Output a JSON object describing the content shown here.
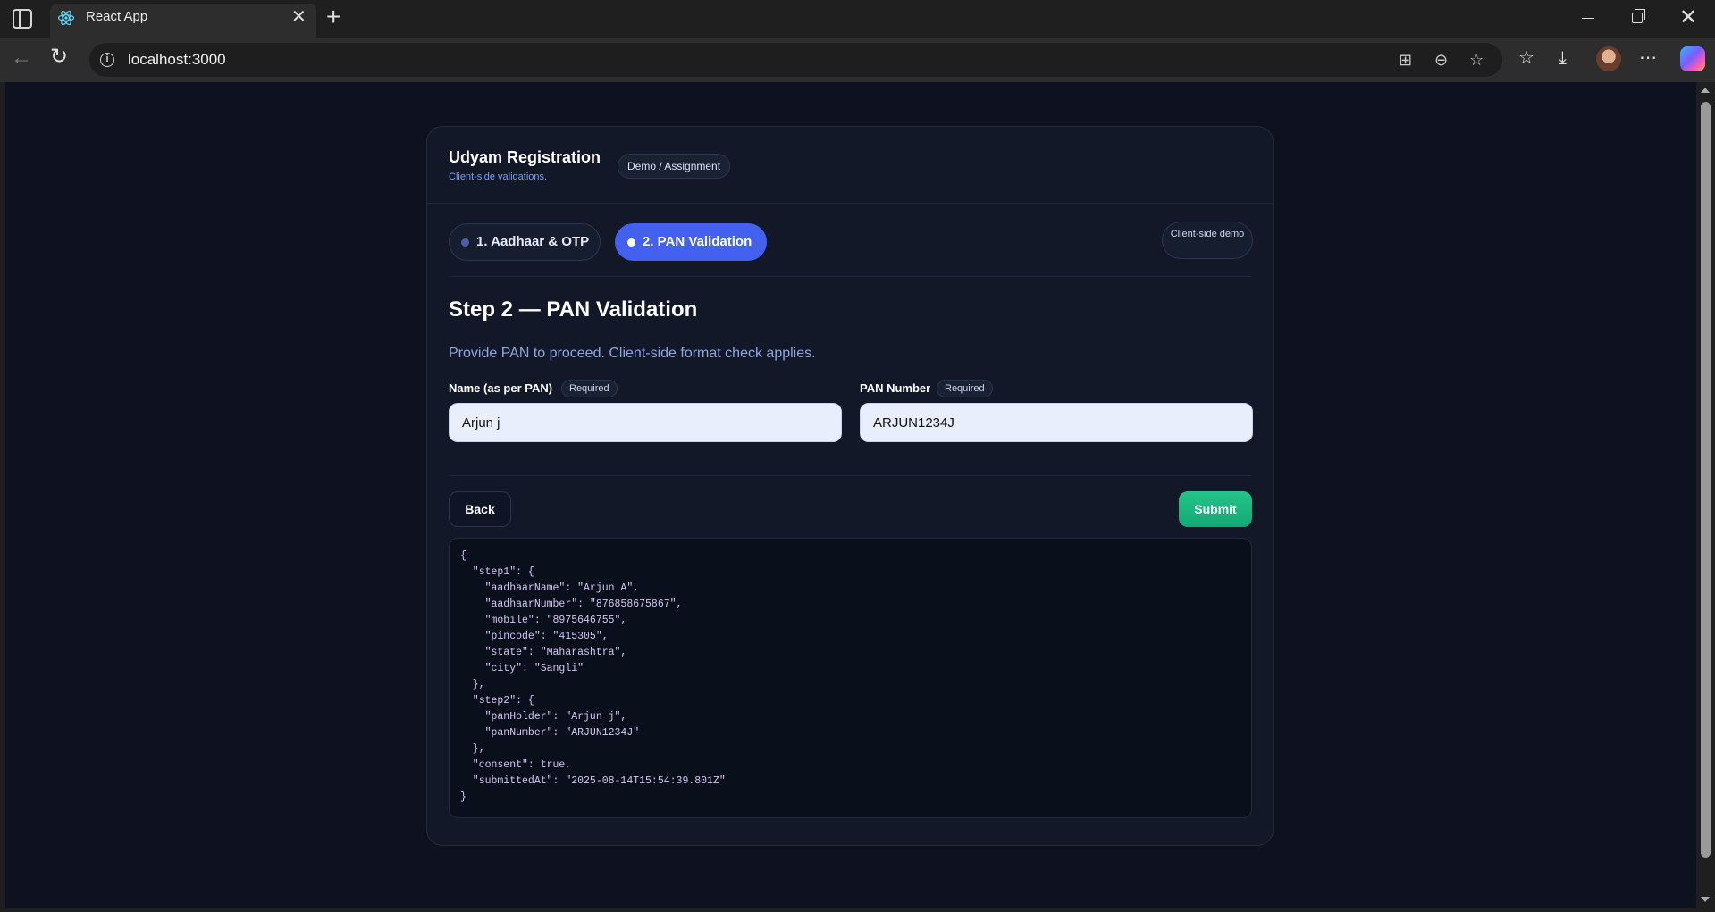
{
  "browser": {
    "tab_title": "React App",
    "url": "localhost:3000"
  },
  "colors": {
    "page_bg": "#0d1120",
    "card_bg": "#121828",
    "accent": "#4361ee",
    "submit": "#1ab27f",
    "subtitle": "#7f9cf5"
  },
  "header": {
    "title": "Udyam Registration",
    "subtitle": "Client-side validations.",
    "badge": "Demo / Assignment"
  },
  "steps": {
    "tabs": [
      {
        "label": "1. Aadhaar & OTP",
        "active": false
      },
      {
        "label": "2. PAN Validation",
        "active": true
      }
    ],
    "mode_badge": "Client-side demo"
  },
  "form": {
    "heading": "Step 2 — PAN Validation",
    "description": "Provide PAN to proceed. Client-side format check applies.",
    "fields": [
      {
        "label": "Name (as per PAN)",
        "required_badge": "Required",
        "value": "Arjun j"
      },
      {
        "label": "PAN Number",
        "required_badge": "Required",
        "value": "ARJUN1234J"
      }
    ]
  },
  "actions": {
    "back_label": "Back",
    "submit_label": "Submit"
  },
  "output_json": "{\n  \"step1\": {\n    \"aadhaarName\": \"Arjun A\",\n    \"aadhaarNumber\": \"876858675867\",\n    \"mobile\": \"8975646755\",\n    \"pincode\": \"415305\",\n    \"state\": \"Maharashtra\",\n    \"city\": \"Sangli\"\n  },\n  \"step2\": {\n    \"panHolder\": \"Arjun j\",\n    \"panNumber\": \"ARJUN1234J\"\n  },\n  \"consent\": true,\n  \"submittedAt\": \"2025-08-14T15:54:39.801Z\"\n}"
}
